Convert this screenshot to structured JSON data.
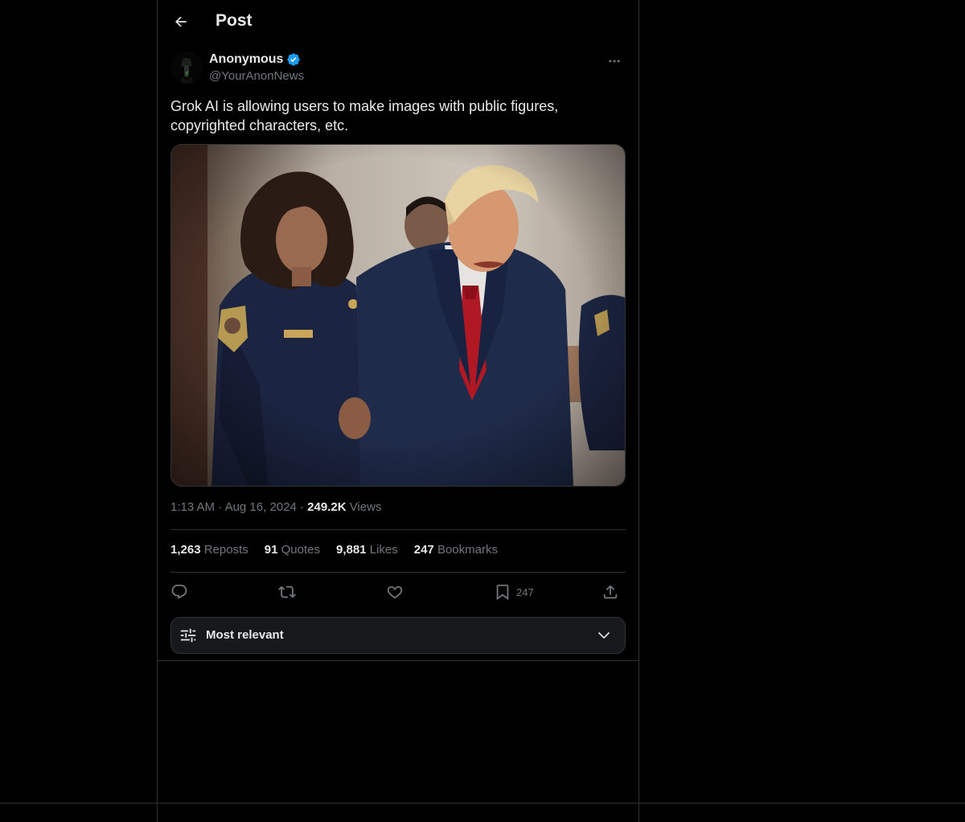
{
  "header": {
    "title": "Post",
    "back_icon": "arrow-left-icon"
  },
  "author": {
    "name": "Anonymous",
    "handle": "@YourAnonNews",
    "verified_color": "#1d9bf0"
  },
  "post": {
    "text": "Grok AI is allowing users to make images with public figures, copyrighted characters, etc.",
    "time": "1:13 AM",
    "date": "Aug 16, 2024",
    "views_count": "249.2K",
    "views_label": "Views"
  },
  "stats": {
    "reposts_count": "1,263",
    "reposts_label": "Reposts",
    "quotes_count": "91",
    "quotes_label": "Quotes",
    "likes_count": "9,881",
    "likes_label": "Likes",
    "bookmarks_count": "247",
    "bookmarks_label": "Bookmarks"
  },
  "actions": {
    "bookmark_count": "247"
  },
  "sort": {
    "label": "Most relevant"
  },
  "colors": {
    "background": "#000000",
    "text": "#e7e9ea",
    "muted": "#71767b",
    "border": "#2f3336",
    "accent": "#1d9bf0"
  }
}
